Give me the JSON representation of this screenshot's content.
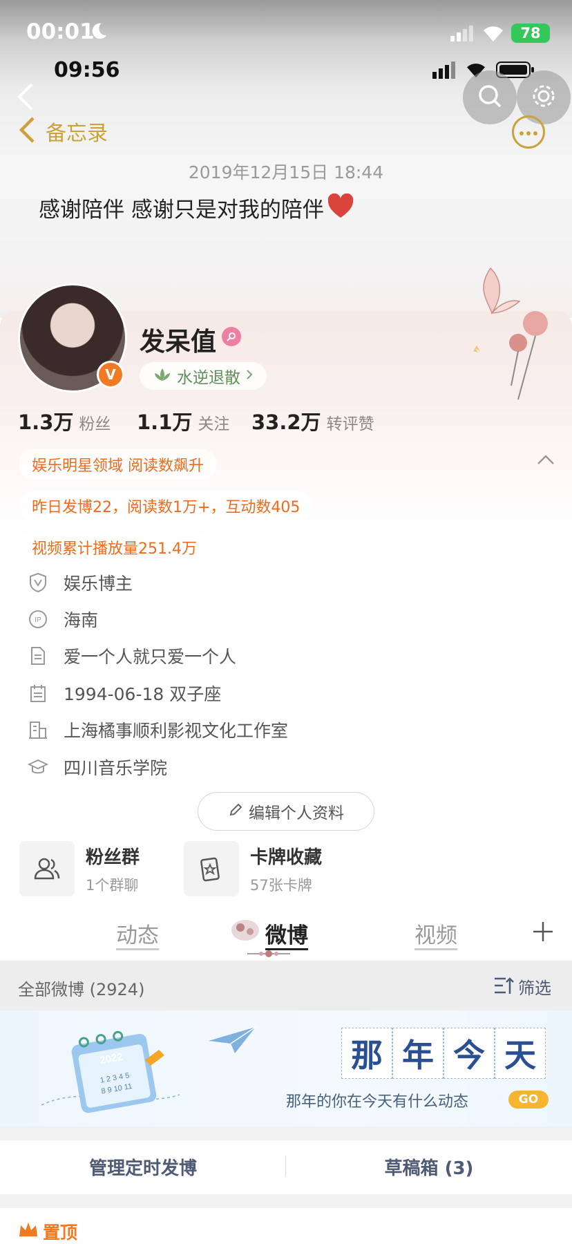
{
  "status_bar": {
    "time": "00:01",
    "battery": "78"
  },
  "inner_status": {
    "time": "09:56"
  },
  "header": {
    "back_label": "备忘录"
  },
  "memo": {
    "date": "2019年12月15日 18:44",
    "text": "感谢陪伴 感谢只是对我的陪伴"
  },
  "profile": {
    "name": "发呆值",
    "verify_badge": "V",
    "group_tag": "水逆退散",
    "stats": [
      {
        "value": "1.3万",
        "label": "粉丝"
      },
      {
        "value": "1.1万",
        "label": "关注"
      },
      {
        "value": "33.2万",
        "label": "转评赞"
      }
    ],
    "highlights": [
      "娱乐明星领域 阅读数飙升",
      "昨日发博22，阅读数1万+，互动数405",
      "视频累计播放量251.4万"
    ],
    "info": [
      {
        "icon": "shield-v-icon",
        "text": "娱乐博主"
      },
      {
        "icon": "ip-icon",
        "text": "海南"
      },
      {
        "icon": "document-icon",
        "text": "爱一个人就只爱一个人"
      },
      {
        "icon": "calendar-icon",
        "text": "1994-06-18 双子座"
      },
      {
        "icon": "building-icon",
        "text": "上海橘事顺利影视文化工作室"
      },
      {
        "icon": "graduation-cap-icon",
        "text": "四川音乐学院"
      }
    ],
    "edit_button": "编辑个人资料"
  },
  "cards": [
    {
      "icon": "people-icon",
      "title": "粉丝群",
      "sub": "1个群聊"
    },
    {
      "icon": "card-star-icon",
      "title": "卡牌收藏",
      "sub": "57张卡牌"
    }
  ],
  "tabs": [
    {
      "label": "动态"
    },
    {
      "label": "微博"
    },
    {
      "label": "视频"
    }
  ],
  "feed": {
    "filter_title": "全部微博 (2924)",
    "filter_button": "筛选",
    "banner": {
      "chars": [
        "那",
        "年",
        "今",
        "天"
      ],
      "subtitle": "那年的你在今天有什么动态",
      "go": "GO",
      "calendar_year": "2022"
    },
    "manage_scheduled": "管理定时发博",
    "drafts": "草稿箱 (3)",
    "pinned": "置顶"
  },
  "colors": {
    "gold": "#c8a33b",
    "orange": "#ee6b1e",
    "accent_blue": "#2a4f93"
  }
}
